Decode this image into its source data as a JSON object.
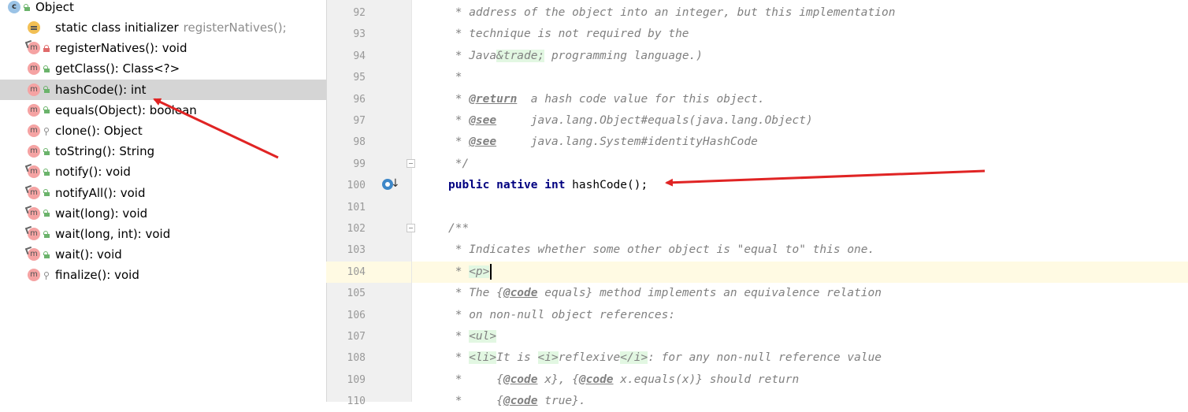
{
  "structure": {
    "root": {
      "name": "Object",
      "icon": "class-icon",
      "badge": "c"
    },
    "members": [
      {
        "name": "static class initializer",
        "type": "registerNatives();",
        "icon": "class-initializer-icon",
        "visibility": "none",
        "selected": false
      },
      {
        "name": "registerNatives(): void",
        "icon": "method-icon",
        "visibility": "private",
        "overlay": true,
        "selected": false
      },
      {
        "name": "getClass(): Class<?>",
        "icon": "method-icon",
        "visibility": "public",
        "overlay": false,
        "selected": false
      },
      {
        "name": "hashCode(): int",
        "icon": "method-icon",
        "visibility": "public",
        "overlay": false,
        "selected": true
      },
      {
        "name": "equals(Object): boolean",
        "icon": "method-icon",
        "visibility": "public",
        "overlay": false,
        "selected": false
      },
      {
        "name": "clone(): Object",
        "icon": "method-icon",
        "visibility": "protected",
        "overlay": false,
        "selected": false
      },
      {
        "name": "toString(): String",
        "icon": "method-icon",
        "visibility": "public",
        "overlay": false,
        "selected": false
      },
      {
        "name": "notify(): void",
        "icon": "method-icon",
        "visibility": "public",
        "overlay": true,
        "selected": false
      },
      {
        "name": "notifyAll(): void",
        "icon": "method-icon",
        "visibility": "public",
        "overlay": true,
        "selected": false
      },
      {
        "name": "wait(long): void",
        "icon": "method-icon",
        "visibility": "public",
        "overlay": true,
        "selected": false
      },
      {
        "name": "wait(long, int): void",
        "icon": "method-icon",
        "visibility": "public",
        "overlay": true,
        "selected": false
      },
      {
        "name": "wait(): void",
        "icon": "method-icon",
        "visibility": "public",
        "overlay": true,
        "selected": false
      },
      {
        "name": "finalize(): void",
        "icon": "method-icon",
        "visibility": "protected",
        "overlay": false,
        "selected": false
      }
    ]
  },
  "editor": {
    "current_line": 104,
    "lines": [
      {
        "num": "92",
        "segments": [
          {
            "t": " * address of the object into an integer, but this implementation",
            "c": "cm"
          }
        ]
      },
      {
        "num": "93",
        "segments": [
          {
            "t": " * technique is not required by the",
            "c": "cm"
          }
        ]
      },
      {
        "num": "94",
        "segments": [
          {
            "t": " * Java",
            "c": "cm"
          },
          {
            "t": "&trade;",
            "c": "html-tag"
          },
          {
            "t": " programming language.)",
            "c": "cm"
          }
        ]
      },
      {
        "num": "95",
        "segments": [
          {
            "t": " *",
            "c": "cm"
          }
        ]
      },
      {
        "num": "96",
        "segments": [
          {
            "t": " * ",
            "c": "cm"
          },
          {
            "t": "@return",
            "c": "tag"
          },
          {
            "t": "  a hash code value for this object.",
            "c": "cm"
          }
        ]
      },
      {
        "num": "97",
        "segments": [
          {
            "t": " * ",
            "c": "cm"
          },
          {
            "t": "@see",
            "c": "tag"
          },
          {
            "t": "     java.lang.Object#equals(java.lang.Object)",
            "c": "cm"
          }
        ]
      },
      {
        "num": "98",
        "segments": [
          {
            "t": " * ",
            "c": "cm"
          },
          {
            "t": "@see",
            "c": "tag"
          },
          {
            "t": "     java.lang.System#identityHashCode",
            "c": "cm"
          }
        ]
      },
      {
        "num": "99",
        "segments": [
          {
            "t": " */",
            "c": "cm"
          }
        ]
      },
      {
        "num": "100",
        "segments": [
          {
            "t": "public",
            "c": "kw"
          },
          {
            "t": " ",
            "c": ""
          },
          {
            "t": "native",
            "c": "kw"
          },
          {
            "t": " ",
            "c": ""
          },
          {
            "t": "int",
            "c": "kw"
          },
          {
            "t": " hashCode();",
            "c": ""
          }
        ]
      },
      {
        "num": "101",
        "segments": []
      },
      {
        "num": "102",
        "segments": [
          {
            "t": "/**",
            "c": "cm"
          }
        ]
      },
      {
        "num": "103",
        "segments": [
          {
            "t": " * Indicates whether some other object is \"equal to\" this one.",
            "c": "cm"
          }
        ]
      },
      {
        "num": "104",
        "segments": [
          {
            "t": " * ",
            "c": "cm"
          },
          {
            "t": "<p>",
            "c": "html-tag"
          }
        ],
        "caret": true
      },
      {
        "num": "105",
        "segments": [
          {
            "t": " * The {",
            "c": "cm"
          },
          {
            "t": "@code",
            "c": "tag"
          },
          {
            "t": " equals} method implements an equivalence relation",
            "c": "cm"
          }
        ]
      },
      {
        "num": "106",
        "segments": [
          {
            "t": " * on non-null object references:",
            "c": "cm"
          }
        ]
      },
      {
        "num": "107",
        "segments": [
          {
            "t": " * ",
            "c": "cm"
          },
          {
            "t": "<ul>",
            "c": "html-tag"
          }
        ]
      },
      {
        "num": "108",
        "segments": [
          {
            "t": " * ",
            "c": "cm"
          },
          {
            "t": "<li>",
            "c": "html-tag"
          },
          {
            "t": "It is ",
            "c": "cm"
          },
          {
            "t": "<i>",
            "c": "html-tag"
          },
          {
            "t": "reflexive",
            "c": "cm"
          },
          {
            "t": "</i>",
            "c": "html-tag"
          },
          {
            "t": ": for any non-null reference value",
            "c": "cm"
          }
        ]
      },
      {
        "num": "109",
        "segments": [
          {
            "t": " *     {",
            "c": "cm"
          },
          {
            "t": "@code",
            "c": "tag"
          },
          {
            "t": " x}, {",
            "c": "cm"
          },
          {
            "t": "@code",
            "c": "tag"
          },
          {
            "t": " x.equals(x)} should return",
            "c": "cm"
          }
        ]
      },
      {
        "num": "110",
        "segments": [
          {
            "t": " *     {",
            "c": "cm"
          },
          {
            "t": "@code",
            "c": "tag"
          },
          {
            "t": " true}.",
            "c": "cm"
          }
        ]
      }
    ]
  },
  "colors": {
    "annotation_arrow": "#e02424",
    "selection_bg": "#d5d5d5",
    "current_line_bg": "#fffae3",
    "keyword": "#000080",
    "comment": "#808080"
  }
}
